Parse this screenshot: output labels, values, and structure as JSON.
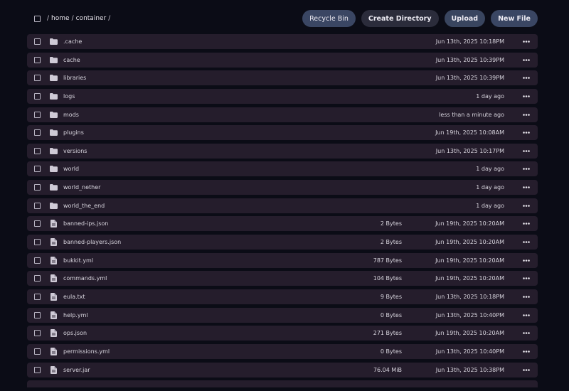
{
  "breadcrumb": {
    "parts": [
      "home",
      "container"
    ]
  },
  "toolbar": {
    "recycle_bin_label": "Recycle Bin",
    "create_directory_label": "Create Directory",
    "upload_label": "Upload",
    "new_file_label": "New File"
  },
  "files": [
    {
      "type": "folder",
      "name": ".cache",
      "size": "",
      "modified": "Jun 13th, 2025 10:18PM"
    },
    {
      "type": "folder",
      "name": "cache",
      "size": "",
      "modified": "Jun 13th, 2025 10:39PM"
    },
    {
      "type": "folder",
      "name": "libraries",
      "size": "",
      "modified": "Jun 13th, 2025 10:39PM"
    },
    {
      "type": "folder",
      "name": "logs",
      "size": "",
      "modified": "1 day ago"
    },
    {
      "type": "folder",
      "name": "mods",
      "size": "",
      "modified": "less than a minute ago"
    },
    {
      "type": "folder",
      "name": "plugins",
      "size": "",
      "modified": "Jun 19th, 2025 10:08AM"
    },
    {
      "type": "folder",
      "name": "versions",
      "size": "",
      "modified": "Jun 13th, 2025 10:17PM"
    },
    {
      "type": "folder",
      "name": "world",
      "size": "",
      "modified": "1 day ago"
    },
    {
      "type": "folder",
      "name": "world_nether",
      "size": "",
      "modified": "1 day ago"
    },
    {
      "type": "folder",
      "name": "world_the_end",
      "size": "",
      "modified": "1 day ago"
    },
    {
      "type": "file",
      "name": "banned-ips.json",
      "size": "2 Bytes",
      "modified": "Jun 19th, 2025 10:20AM"
    },
    {
      "type": "file",
      "name": "banned-players.json",
      "size": "2 Bytes",
      "modified": "Jun 19th, 2025 10:20AM"
    },
    {
      "type": "file",
      "name": "bukkit.yml",
      "size": "787 Bytes",
      "modified": "Jun 19th, 2025 10:20AM"
    },
    {
      "type": "file",
      "name": "commands.yml",
      "size": "104 Bytes",
      "modified": "Jun 19th, 2025 10:20AM"
    },
    {
      "type": "file",
      "name": "eula.txt",
      "size": "9 Bytes",
      "modified": "Jun 13th, 2025 10:18PM"
    },
    {
      "type": "file",
      "name": "help.yml",
      "size": "0 Bytes",
      "modified": "Jun 13th, 2025 10:40PM"
    },
    {
      "type": "file",
      "name": "ops.json",
      "size": "271 Bytes",
      "modified": "Jun 19th, 2025 10:20AM"
    },
    {
      "type": "file",
      "name": "permissions.yml",
      "size": "0 Bytes",
      "modified": "Jun 13th, 2025 10:40PM"
    },
    {
      "type": "file",
      "name": "server.jar",
      "size": "76.04 MiB",
      "modified": "Jun 13th, 2025 10:38PM"
    }
  ],
  "icons": {
    "folder": "folder-icon",
    "file": "file-icon",
    "more": "more-options-icon"
  },
  "colors": {
    "background": "#0b0c16",
    "row_background": "#251d2c",
    "button_accent": "#3a4663"
  }
}
